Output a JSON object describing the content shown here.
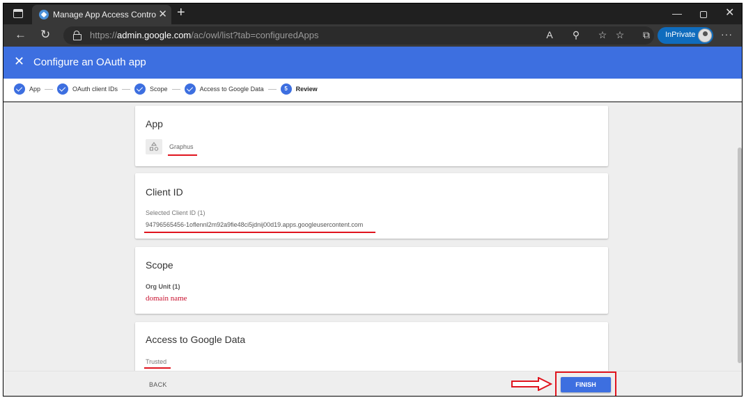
{
  "browser": {
    "tab_title": "Manage App Access Control - Ac",
    "url_prefix": "https://",
    "url_domain": "admin.google.com",
    "url_path": "/ac/owl/list?tab=configuredApps",
    "inprivate_label": "InPrivate"
  },
  "header": {
    "title": "Configure an OAuth app"
  },
  "stepper": {
    "steps": [
      {
        "label": "App",
        "state": "done"
      },
      {
        "label": "OAuth client IDs",
        "state": "done"
      },
      {
        "label": "Scope",
        "state": "done"
      },
      {
        "label": "Access to Google Data",
        "state": "done"
      },
      {
        "label": "Review",
        "number": "5",
        "state": "active"
      }
    ]
  },
  "cards": {
    "app": {
      "title": "App",
      "app_name": "Graphus"
    },
    "client": {
      "title": "Client ID",
      "label": "Selected Client ID (1)",
      "value": "94796565456-1oflennl2m92a9fie48ci5jdnij00d19.apps.googleusercontent.com"
    },
    "scope": {
      "title": "Scope",
      "label": "Org Unit (1)",
      "value": "domain name"
    },
    "access": {
      "title": "Access to Google Data",
      "value": "Trusted"
    }
  },
  "footer": {
    "back_label": "BACK",
    "finish_label": "FINISH"
  },
  "colors": {
    "accent": "#3d6fe0",
    "highlight": "#e0141e"
  }
}
